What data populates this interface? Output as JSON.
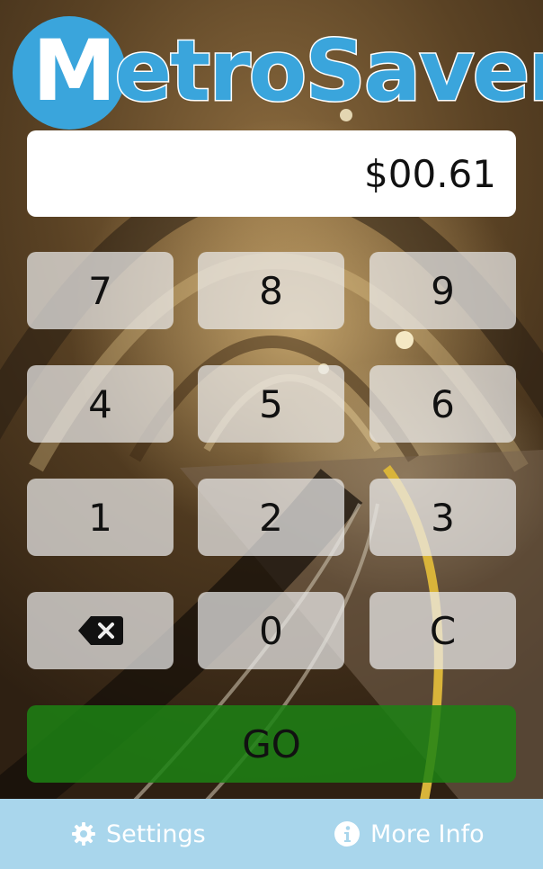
{
  "app": {
    "logo_first_letter": "M",
    "logo_rest": "etroSaver",
    "brand_color": "#3aa5dc"
  },
  "display": {
    "amount": "$00.61"
  },
  "keypad": {
    "keys": [
      "7",
      "8",
      "9",
      "4",
      "5",
      "6",
      "1",
      "2",
      "3",
      "0",
      "C"
    ],
    "backspace_icon": "backspace-icon",
    "go_label": "GO",
    "go_color": "#1c8214"
  },
  "footer": {
    "settings_label": "Settings",
    "settings_icon": "gear-icon",
    "info_label": "More Info",
    "info_icon": "info-icon",
    "background_color": "#a9d6ec"
  }
}
